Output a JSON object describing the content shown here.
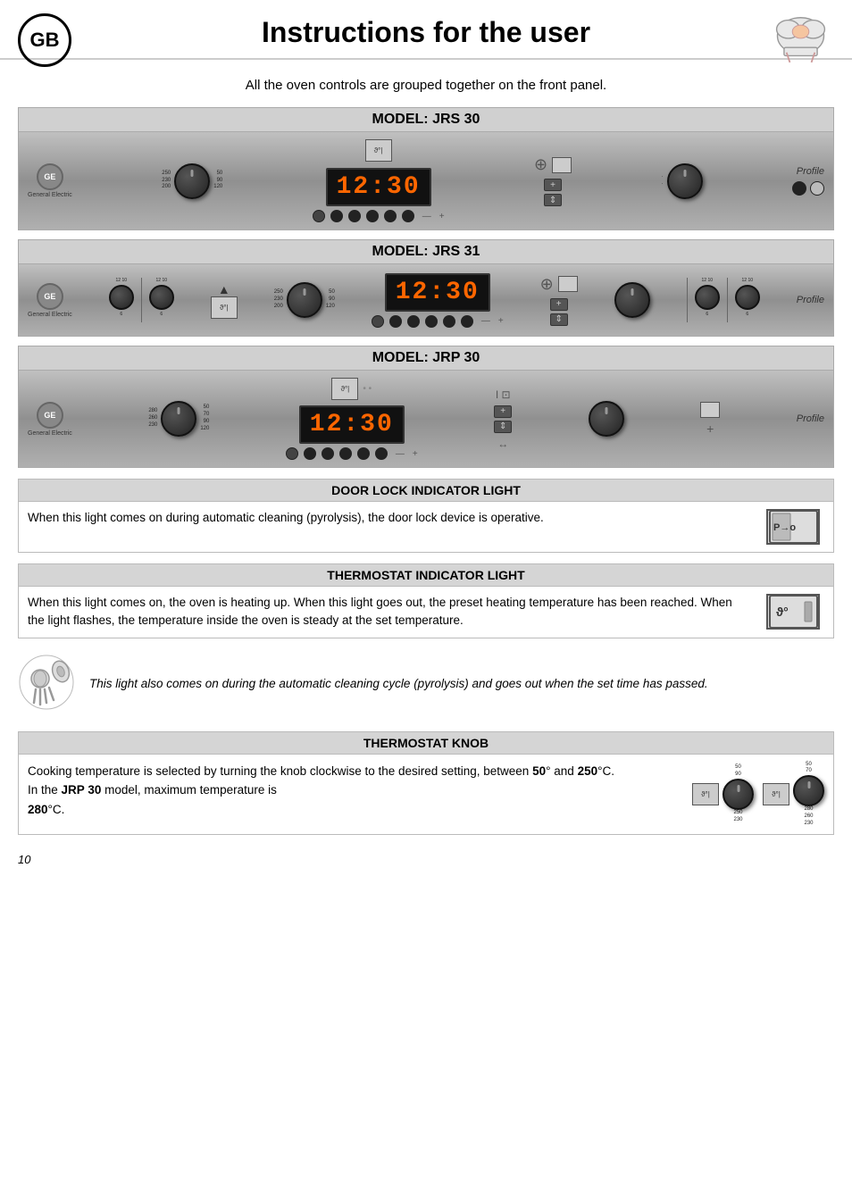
{
  "header": {
    "gb_label": "GB",
    "title": "Instructions for the user"
  },
  "intro": {
    "text": "All the oven controls are grouped together on the front panel."
  },
  "models": [
    {
      "id": "jrs30",
      "label": "MODEL: JRS 30",
      "ge_text": "General Electric",
      "display": "12:30",
      "profile": "Profile"
    },
    {
      "id": "jrs31",
      "label": "MODEL: JRS 31",
      "ge_text": "General Electric",
      "display": "12:30",
      "profile": "Profile"
    },
    {
      "id": "jrp30",
      "label": "MODEL: JRP 30",
      "ge_text": "General Electric",
      "display": "12:30",
      "profile": "Profile"
    }
  ],
  "sections": {
    "door_lock": {
      "header": "DOOR LOCK INDICATOR LIGHT",
      "text": "When  this  light  comes  on  during  automatic  cleaning (pyrolysis), the door lock device is operative.",
      "icon_label": "P→o"
    },
    "thermostat_indicator": {
      "header": "THERMOSTAT INDICATOR LIGHT",
      "text": "When this light comes on, the oven is heating up. When this light  goes  out,  the  preset  heating  temperature  has  been reached.  When  the  light  flashes,  the  temperature  inside  the oven is steady at the set temperature.",
      "icon_label": "ϑ°"
    },
    "italic_note": {
      "text": "This light also comes on during the automatic cleaning cycle (pyrolysis) and goes out when the set time has passed."
    },
    "thermostat_knob": {
      "header": "THERMOSTAT KNOB",
      "text_1": "Cooking temperature is selected by turning the knob clockwise to the desired setting, between",
      "bold_50": "50",
      "text_2": "° and",
      "bold_250": "250",
      "text_3": "°C.",
      "text_4": "In the",
      "bold_jrp": "JRP 30",
      "text_5": "model, maximum temperature is",
      "bold_280": "280",
      "text_6": "°C."
    }
  },
  "page_number": "10"
}
